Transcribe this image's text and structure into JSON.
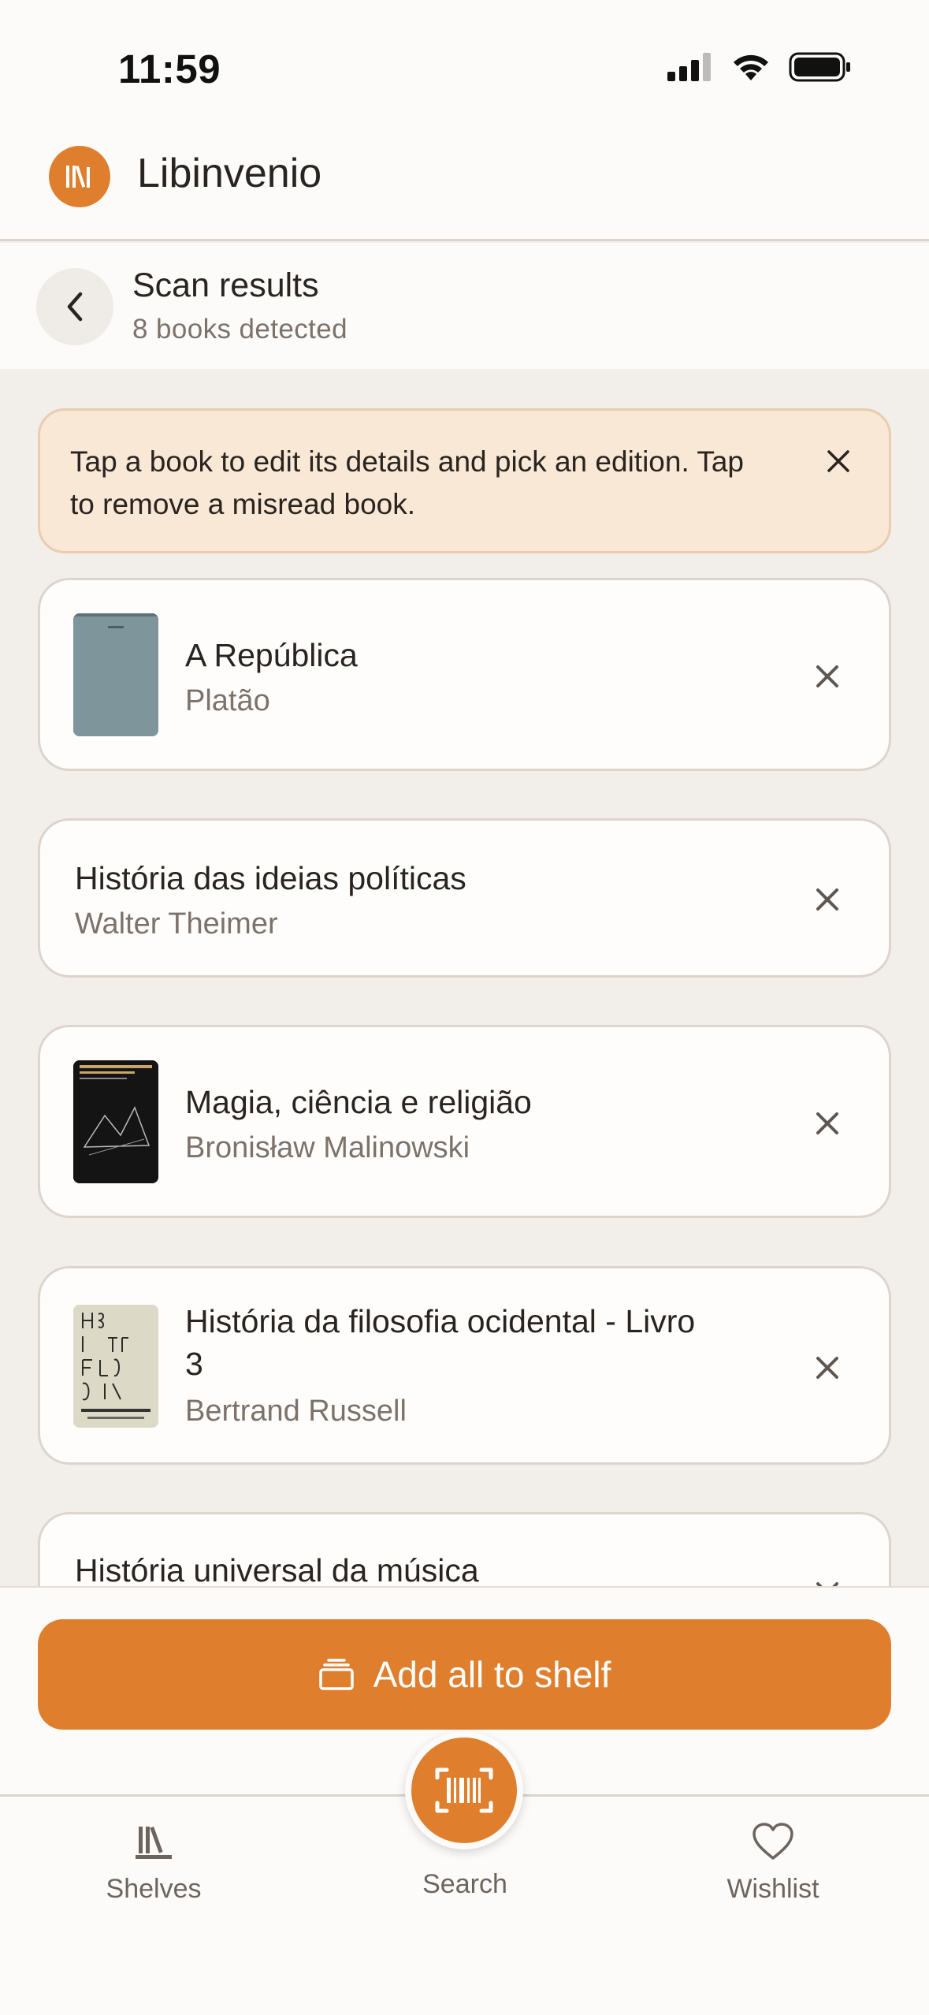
{
  "status_bar": {
    "time": "11:59"
  },
  "app": {
    "title": "Libinvenio"
  },
  "scan": {
    "title": "Scan results",
    "subtitle": "8 books detected"
  },
  "info": {
    "line1": "Tap a book to edit its details and pick an edition. Tap",
    "line2": "to remove a misread book."
  },
  "books": [
    {
      "title": "A República",
      "author": "Platão",
      "has_cover": true
    },
    {
      "title": "História das ideias políticas",
      "author": "Walter Theimer",
      "has_cover": false
    },
    {
      "title": "Magia, ciência e religião",
      "author": "Bronisław Malinowski",
      "has_cover": true
    },
    {
      "title_line1": "História da filosofia ocidental - Livro",
      "title_line2": "3",
      "author": "Bertrand Russell",
      "has_cover": true
    },
    {
      "title": "História universal da música",
      "author": "",
      "has_cover": false
    }
  ],
  "actions": {
    "add_all": "Add all to shelf"
  },
  "tabs": {
    "shelves": "Shelves",
    "search": "Search",
    "wishlist": "Wishlist"
  },
  "colors": {
    "accent": "#df7f2e",
    "banner_bg": "#f8e8d5",
    "page_bg": "#f2efeb"
  }
}
